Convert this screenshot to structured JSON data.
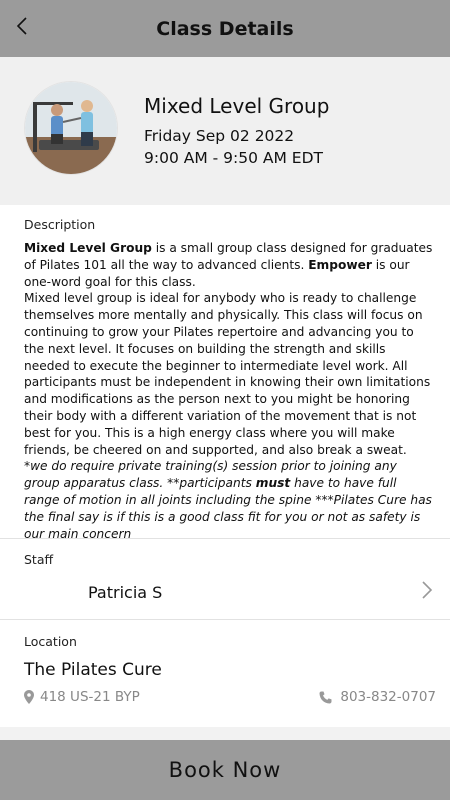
{
  "header": {
    "title": "Class Details",
    "back_icon": "chevron-left-icon"
  },
  "class": {
    "name": "Mixed Level Group",
    "date": "Friday Sep 02 2022",
    "time": "9:00 AM - 9:50 AM EDT"
  },
  "description": {
    "label": "Description",
    "p1_bold1": "Mixed Level Group",
    "p1_text1": " is a small group class designed for graduates of Pilates 101 all the way to advanced clients. ",
    "p1_bold2": "Empower",
    "p1_text2": " is our one-word goal for this class.",
    "p2": "Mixed level group is ideal for anybody who is ready to challenge themselves more mentally and physically. This class will focus on continuing to grow your Pilates repertoire and advancing you to the next level. It focuses on building the strength and skills needed to execute the beginner to intermediate level work. All participants must be independent in knowing their own limitations and modifications as the person next to you might be honoring their body with a different variation of the movement that is not best for you. This is a high energy class where you will make friends, be cheered on and supported, and also break a sweat.",
    "p3_text1": "*we do require private training(s) session prior to joining any group apparatus class. **participants ",
    "p3_bold": "must",
    "p3_text2": " have to have full range of motion in all joints including the spine    ***Pilates Cure has the final say is if this is a good class fit for you or not as safety is our main concern"
  },
  "staff": {
    "label": "Staff",
    "name": "Patricia S"
  },
  "location": {
    "label": "Location",
    "name": "The Pilates Cure",
    "address": "418 US-21 BYP",
    "phone": "803-832-0707"
  },
  "footer": {
    "book_label": "Book Now"
  },
  "colors": {
    "header_bg": "#9b9b9b",
    "hero_bg": "#f0f0f0",
    "muted_text": "#888888"
  }
}
